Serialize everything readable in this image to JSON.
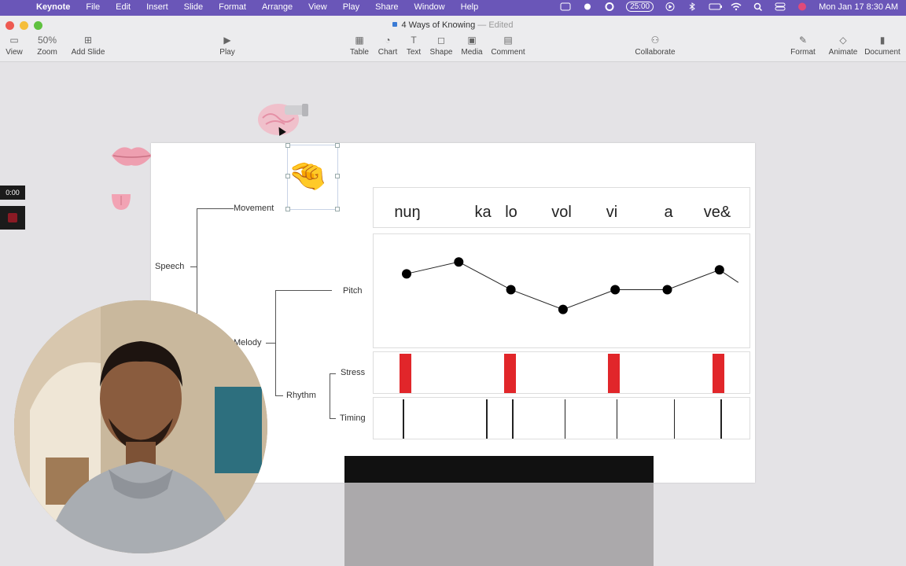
{
  "menubar": {
    "app": "Keynote",
    "items": [
      "File",
      "Edit",
      "Insert",
      "Slide",
      "Format",
      "Arrange",
      "View",
      "Play",
      "Share",
      "Window",
      "Help"
    ],
    "timer": "25:00",
    "clock": "Mon Jan 17  8:30 AM"
  },
  "window": {
    "title": "4 Ways of Knowing",
    "separator": "—",
    "status": "Edited"
  },
  "toolbar": {
    "view": "View",
    "zoom_value": "50%",
    "zoom": "Zoom",
    "add_slide": "Add Slide",
    "play": "Play",
    "table": "Table",
    "chart": "Chart",
    "text": "Text",
    "shape": "Shape",
    "media": "Media",
    "comment": "Comment",
    "collaborate": "Collaborate",
    "format": "Format",
    "animate": "Animate",
    "document": "Document"
  },
  "recorder": {
    "time": "0:00"
  },
  "slide": {
    "tree": {
      "speech": "Speech",
      "movement": "Movement",
      "melody": "Melody",
      "pitch": "Pitch",
      "rhythm": "Rhythm",
      "stress": "Stress",
      "timing": "Timing"
    },
    "syllables": [
      "nuŋ",
      "ka",
      "lo",
      "vol",
      "vi",
      "a",
      "ve&"
    ]
  },
  "chart_data": {
    "type": "line",
    "x": [
      1,
      2,
      3,
      4,
      5,
      6,
      7
    ],
    "values": [
      3.4,
      4.0,
      2.6,
      1.6,
      2.6,
      2.6,
      3.6
    ],
    "ylim": [
      0,
      5
    ],
    "stress_positions": [
      1,
      3,
      5,
      7
    ],
    "timing_positions": [
      1,
      2.6,
      3.1,
      4.1,
      5.1,
      6.2,
      7.1
    ],
    "grid": false,
    "colors": {
      "stress": "#e1262a",
      "line": "#222222",
      "point": "#000000"
    }
  }
}
